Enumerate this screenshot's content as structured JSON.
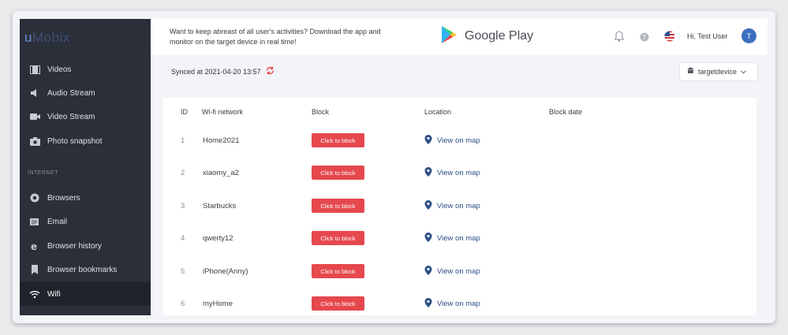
{
  "brand": {
    "logo_u": "u",
    "logo_rest": "Mobix"
  },
  "sidebar": {
    "items": [
      {
        "label": "Videos",
        "icon": "film-icon"
      },
      {
        "label": "Audio Stream",
        "icon": "speaker-icon"
      },
      {
        "label": "Video Stream",
        "icon": "camera-icon"
      },
      {
        "label": "Photo snapshot",
        "icon": "photo-camera-icon"
      }
    ],
    "section_internet": "INTERNET",
    "internet_items": [
      {
        "label": "Browsers",
        "icon": "chrome-icon"
      },
      {
        "label": "Email",
        "icon": "email-icon"
      },
      {
        "label": "Browser history",
        "icon": "ie-icon"
      },
      {
        "label": "Browser bookmarks",
        "icon": "bookmark-icon"
      },
      {
        "label": "Wifi",
        "icon": "wifi-icon"
      }
    ]
  },
  "header": {
    "promo": "Want to keep abreast of all user's activities? Download the app and monitor on the target device in real time!",
    "google_play": "Google Play",
    "greeting": "Hi, Test User",
    "avatar_initial": "T"
  },
  "sync": {
    "text": "Synced at 2021-04-20 13:57"
  },
  "device": {
    "name": "targetdevice"
  },
  "table": {
    "headers": {
      "id": "ID",
      "network": "Wi-fi network",
      "block": "Block",
      "location": "Location",
      "block_date": "Block date"
    },
    "block_label": "Click to block",
    "location_label": "View on map",
    "rows": [
      {
        "id": "1",
        "network": "Home2021"
      },
      {
        "id": "2",
        "network": "xiaomy_a2"
      },
      {
        "id": "3",
        "network": "Starbucks"
      },
      {
        "id": "4",
        "network": "qwerty12"
      },
      {
        "id": "5",
        "network": "iPhone(Anny)"
      },
      {
        "id": "6",
        "network": "myHome"
      }
    ]
  },
  "colors": {
    "sidebar": "#2b2f3a",
    "block_button": "#e5484d",
    "link": "#2b4f86",
    "avatar": "#3d6fbf"
  }
}
